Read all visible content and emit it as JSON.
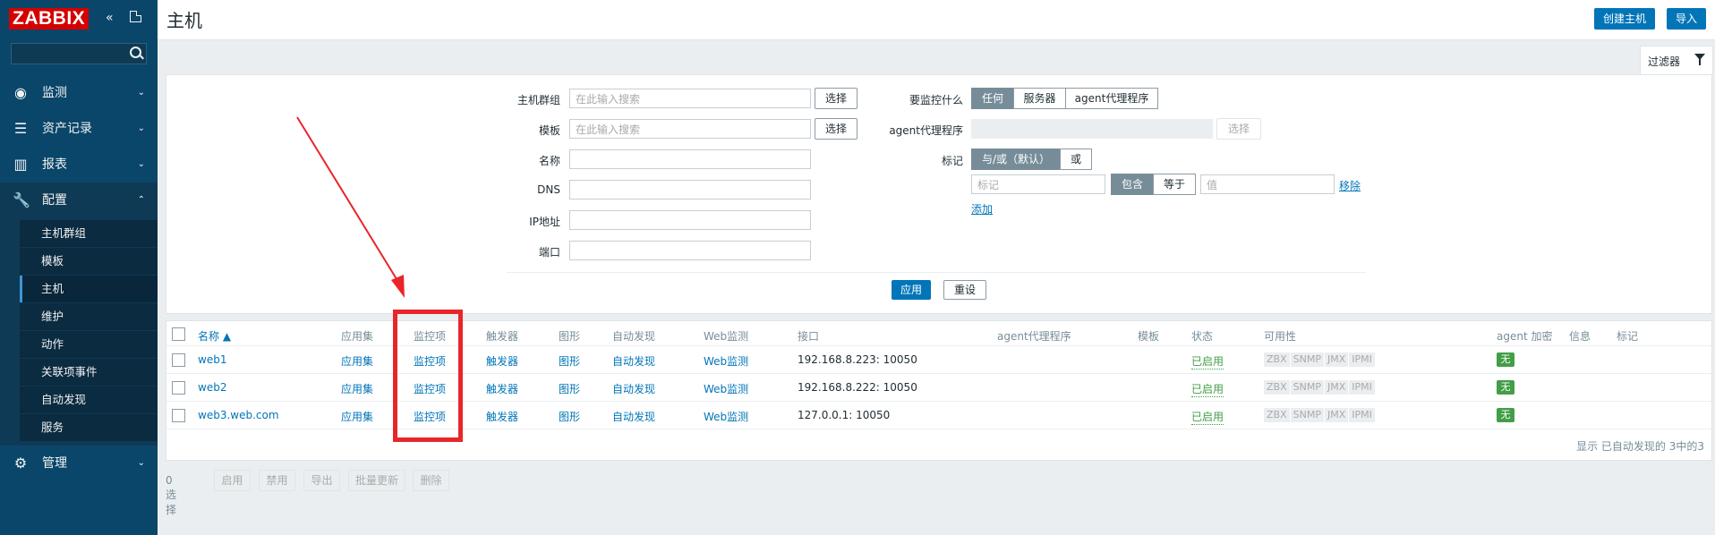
{
  "app": {
    "logo_text": "ZABBIX"
  },
  "sidebar": {
    "collapse_icon": "double-chevron-left",
    "kiosk_icon": "kiosk-mode",
    "search_icon": "search",
    "menu": [
      {
        "label": "监测",
        "icon": "eye-icon"
      },
      {
        "label": "资产记录",
        "icon": "list-icon"
      },
      {
        "label": "报表",
        "icon": "bar-chart-icon"
      },
      {
        "label": "配置",
        "icon": "wrench-icon",
        "expanded": true,
        "submenu": [
          "主机群组",
          "模板",
          "主机",
          "维护",
          "动作",
          "关联项事件",
          "自动发现",
          "服务"
        ],
        "active": "主机"
      },
      {
        "label": "管理",
        "icon": "gear-icon"
      }
    ]
  },
  "header": {
    "title": "主机",
    "create_button": "创建主机",
    "import_button": "导入"
  },
  "filter": {
    "tab_label": "过滤器",
    "host_group_label": "主机群组",
    "host_group_placeholder": "在此输入搜索",
    "template_label": "模板",
    "template_placeholder": "在此输入搜索",
    "select_button": "选择",
    "name_label": "名称",
    "dns_label": "DNS",
    "ip_label": "IP地址",
    "port_label": "端口",
    "monitored_by_label": "要监控什么",
    "monitored_by_options": [
      "任何",
      "服务器",
      "agent代理程序"
    ],
    "proxy_label": "agent代理程序",
    "proxy_select_button": "选择",
    "tags_label": "标记",
    "tags_operator_options": [
      "与/或（默认）",
      "或"
    ],
    "tag_placeholder": "标记",
    "tag_match_options": [
      "包含",
      "等于"
    ],
    "value_placeholder": "值",
    "remove_link": "移除",
    "add_link": "添加",
    "apply_button": "应用",
    "reset_button": "重设"
  },
  "table": {
    "columns": [
      "名称 ▲",
      "应用集",
      "监控项",
      "触发器",
      "图形",
      "自动发现",
      "Web监测",
      "接口",
      "agent代理程序",
      "模板",
      "状态",
      "可用性",
      "agent 加密",
      "信息",
      "标记"
    ],
    "rows": [
      {
        "name": "web1",
        "apps": "应用集",
        "items": "监控项",
        "triggers": "触发器",
        "graphs": "图形",
        "discovery": "自动发现",
        "web": "Web监测",
        "interface": "192.168.8.223: 10050",
        "status": "已启用",
        "encryption": "无"
      },
      {
        "name": "web2",
        "apps": "应用集",
        "items": "监控项",
        "triggers": "触发器",
        "graphs": "图形",
        "discovery": "自动发现",
        "web": "Web监测",
        "interface": "192.168.8.222: 10050",
        "status": "已启用",
        "encryption": "无"
      },
      {
        "name": "web3.web.com",
        "apps": "应用集",
        "items": "监控项",
        "triggers": "触发器",
        "graphs": "图形",
        "discovery": "自动发现",
        "web": "Web监测",
        "interface": "127.0.0.1: 10050",
        "status": "已启用",
        "encryption": "无"
      }
    ],
    "availability_badges": [
      "ZBX",
      "SNMP",
      "JMX",
      "IPMI"
    ],
    "footer": "显示 已自动发现的 3中的3"
  },
  "bulk": {
    "selected": "0 选择",
    "buttons": [
      "启用",
      "禁用",
      "导出",
      "批量更新",
      "删除"
    ]
  },
  "colors": {
    "sidebar": "#0a466a",
    "accent": "#0275b8",
    "logo": "#d40000",
    "status_green": "#429e47",
    "annotation_red": "#e8262a"
  }
}
